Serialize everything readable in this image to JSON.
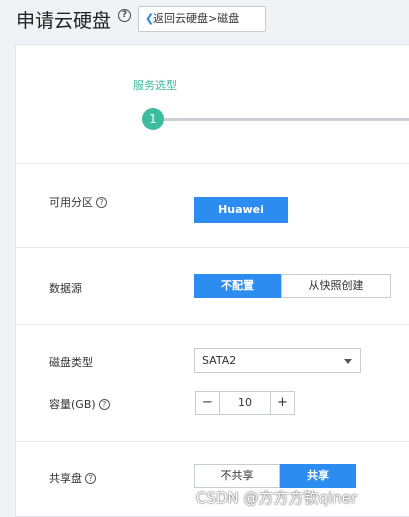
{
  "header": {
    "title": "申请云硬盘",
    "back_label": "返回云硬盘>磁盘"
  },
  "steps": [
    {
      "label": "服务选型",
      "number": "1"
    }
  ],
  "availability_zone": {
    "label": "可用分区",
    "button": "Huawei"
  },
  "data_source": {
    "label": "数据源",
    "options": [
      "不配置",
      "从快照创建"
    ],
    "selected": "不配置"
  },
  "disk_type": {
    "label": "磁盘类型",
    "value": "SATA2"
  },
  "capacity": {
    "label": "容量(GB)",
    "value": "10",
    "minus": "−",
    "plus": "+"
  },
  "shared": {
    "label": "共享盘",
    "options": [
      "不共享",
      "共享"
    ],
    "selected": "共享"
  },
  "help_glyph": "?",
  "watermark": "CSDN @方方方钦qiner",
  "colors": {
    "primary": "#2d8cf0",
    "step": "#3dbb9e",
    "background": "#f0f2f5"
  }
}
